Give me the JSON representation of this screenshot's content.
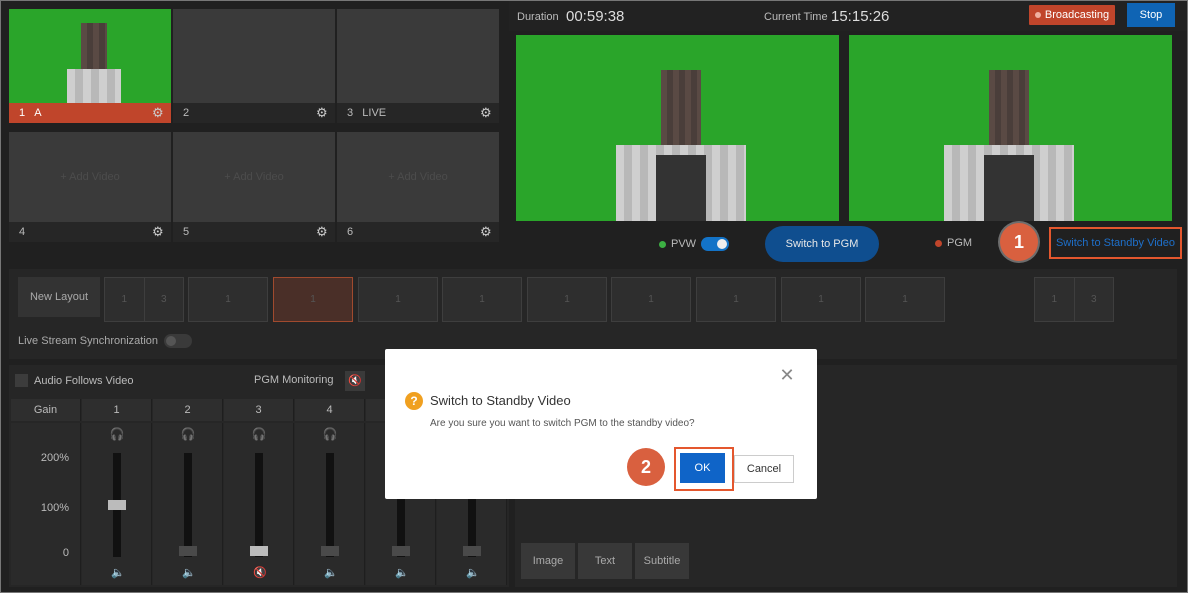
{
  "sources": [
    {
      "index": "1",
      "name": "A",
      "placeholder": ""
    },
    {
      "index": "2",
      "name": "",
      "placeholder": ""
    },
    {
      "index": "3",
      "name": "LIVE",
      "placeholder": ""
    },
    {
      "index": "4",
      "name": "",
      "placeholder": "+ Add Video"
    },
    {
      "index": "5",
      "name": "",
      "placeholder": "+ Add Video"
    },
    {
      "index": "6",
      "name": "",
      "placeholder": "+ Add Video"
    }
  ],
  "header": {
    "duration_label": "Duration",
    "duration_value": "00:59:38",
    "current_time_label": "Current Time",
    "current_time_value": "15:15:26",
    "broadcasting_label": "Broadcasting",
    "stop_label": "Stop"
  },
  "controls": {
    "pvw_label": "PVW",
    "switch_to_pgm_label": "Switch to PGM",
    "pgm_label": "PGM",
    "switch_to_standby_label": "Switch to Standby Video"
  },
  "callouts": {
    "first": "1",
    "second": "2"
  },
  "layouts": {
    "new_layout_label": "New Layout",
    "items": [
      [
        "1",
        "3"
      ],
      [
        "1"
      ],
      [
        "1"
      ],
      [
        "1"
      ],
      [
        "1"
      ],
      [
        "1"
      ],
      [
        "1"
      ],
      [
        "1"
      ],
      [
        "1"
      ],
      [
        "1"
      ],
      [
        "1",
        "3"
      ]
    ],
    "selected_index": 2,
    "live_sync_label": "Live Stream Synchronization"
  },
  "audio": {
    "audio_follows_video_label": "Audio Follows Video",
    "pgm_monitoring_label": "PGM Monitoring",
    "gain_label": "Gain",
    "channels": [
      "1",
      "2",
      "3",
      "4"
    ],
    "scale": [
      "200%",
      "100%",
      "0"
    ],
    "levels": [
      0.5,
      0,
      0,
      0,
      0,
      0
    ]
  },
  "bottom_tabs": [
    "Image",
    "Text",
    "Subtitle"
  ],
  "dialog": {
    "title": "Switch to Standby Video",
    "message": "Are you sure you want to switch PGM to the standby video?",
    "ok_label": "OK",
    "cancel_label": "Cancel",
    "close_icon": "close-icon",
    "question_icon": "question-icon"
  },
  "colors": {
    "accent_red": "#c0452b",
    "accent_blue": "#0f64b4",
    "highlight_orange": "#e4572e",
    "green_screen": "#2aa52a"
  }
}
